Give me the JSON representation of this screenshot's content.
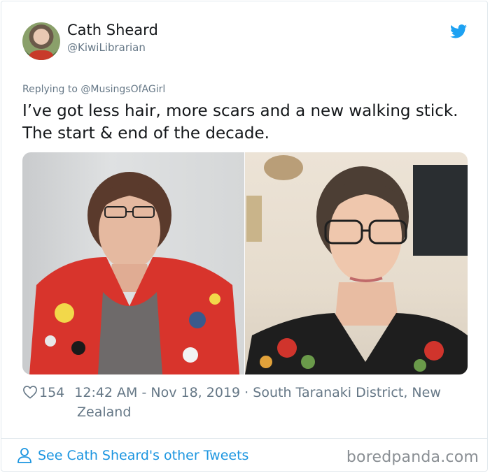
{
  "tweet": {
    "author_name": "Cath Sheard",
    "author_handle": "@KiwiLibrarian",
    "replying_to": "Replying to @MusingsOfAGirl",
    "text": "I’ve got less hair, more scars and a new walking stick. The start & end of the decade.",
    "likes": "154",
    "timestamp": "12:42 AM - Nov 18, 2019",
    "separator": "·",
    "location_line1": "South Taranaki District, New",
    "location_line2": "Zealand"
  },
  "footer": {
    "other_tweets_link": "See Cath Sheard's other Tweets",
    "watermark": "boredpanda.com"
  },
  "colors": {
    "twitter_blue": "#1da1f2",
    "link_blue": "#1b95e0",
    "muted_gray": "#657786"
  },
  "icons": {
    "brand": "twitter-bird-icon",
    "likes": "heart-icon",
    "profile": "person-icon"
  }
}
